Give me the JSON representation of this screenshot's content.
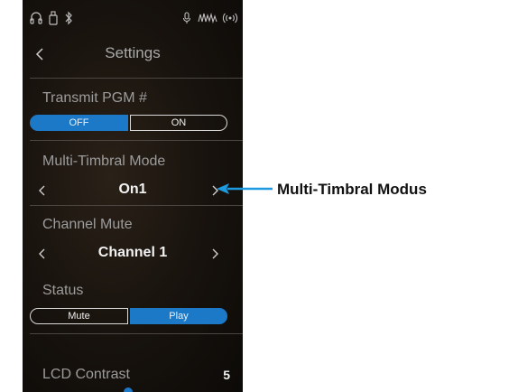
{
  "header": {
    "title": "Settings"
  },
  "transmit_pgm": {
    "label": "Transmit PGM #",
    "off_label": "OFF",
    "on_label": "ON",
    "selected": "OFF"
  },
  "multi_timbral": {
    "label": "Multi-Timbral Mode",
    "value": "On1"
  },
  "channel_mute": {
    "label": "Channel Mute",
    "value": "Channel 1"
  },
  "status": {
    "label": "Status",
    "mute_label": "Mute",
    "play_label": "Play",
    "selected": "Play"
  },
  "lcd_contrast": {
    "label": "LCD Contrast",
    "value": "5"
  },
  "callout": {
    "text": "Multi-Timbral Modus"
  },
  "colors": {
    "accent": "#1c79c8",
    "callout": "#1e9be0"
  },
  "status_icons": [
    "headphones-icon",
    "usb-device-icon",
    "bluetooth-icon",
    "microphone-icon",
    "midi-icon",
    "wifi-audio-icon"
  ]
}
